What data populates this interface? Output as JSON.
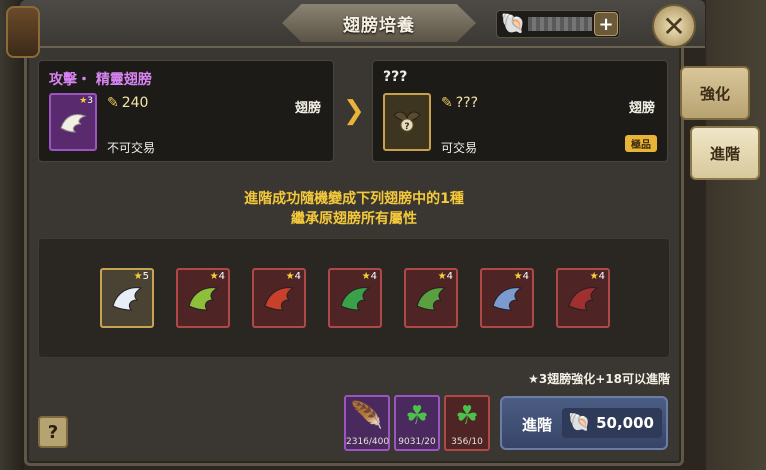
{
  "header": {
    "title": "翅膀培養",
    "plus_label": "+",
    "close_label": "✕"
  },
  "current_item": {
    "name": "攻擊・ 精靈翅膀",
    "stars": "3",
    "power": "240",
    "type": "翅膀",
    "trade": "不可交易",
    "icon": "white-wing-icon"
  },
  "result_item": {
    "name": "???",
    "power": "???",
    "type": "翅膀",
    "trade": "可交易",
    "grade": "極品",
    "icon": "mystery-wing-icon"
  },
  "side_tabs": {
    "enhance": "強化",
    "advance": "進階"
  },
  "info": {
    "line1": "進階成功隨機變成下列翅膀中的1種",
    "line2": "繼承原翅膀所有屬性"
  },
  "options": [
    {
      "stars": "5",
      "name": "white-angel-wing-icon",
      "color": "#e8eef5",
      "frame": "gold"
    },
    {
      "stars": "4",
      "name": "green-leaf-wing-icon",
      "color": "#8fbf3a",
      "frame": "red"
    },
    {
      "stars": "4",
      "name": "red-demon-wing-icon",
      "color": "#c8402a",
      "frame": "red"
    },
    {
      "stars": "4",
      "name": "green-leaf-icon",
      "color": "#3aa04a",
      "frame": "red"
    },
    {
      "stars": "4",
      "name": "dragon-wing-icon",
      "color": "#5aa040",
      "frame": "red"
    },
    {
      "stars": "4",
      "name": "blue-white-wing-icon",
      "color": "#7a9ad0",
      "frame": "red"
    },
    {
      "stars": "4",
      "name": "dark-red-wing-icon",
      "color": "#a03030",
      "frame": "red"
    }
  ],
  "requirement_note": "★3翅膀強化+18可以進階",
  "help_label": "?",
  "materials": [
    {
      "name": "feather-icon",
      "count": "2316/400",
      "frame": "purple"
    },
    {
      "name": "clover-icon",
      "count": "9031/20",
      "frame": "purple"
    },
    {
      "name": "clover-red-icon",
      "count": "356/10",
      "frame": "red"
    }
  ],
  "advance_button": {
    "label": "進階",
    "cost": "50,000"
  },
  "colors": {
    "accent_gold": "#f4c93a",
    "purple_name": "#d784f2",
    "advance_blue": "#4c5d83"
  }
}
